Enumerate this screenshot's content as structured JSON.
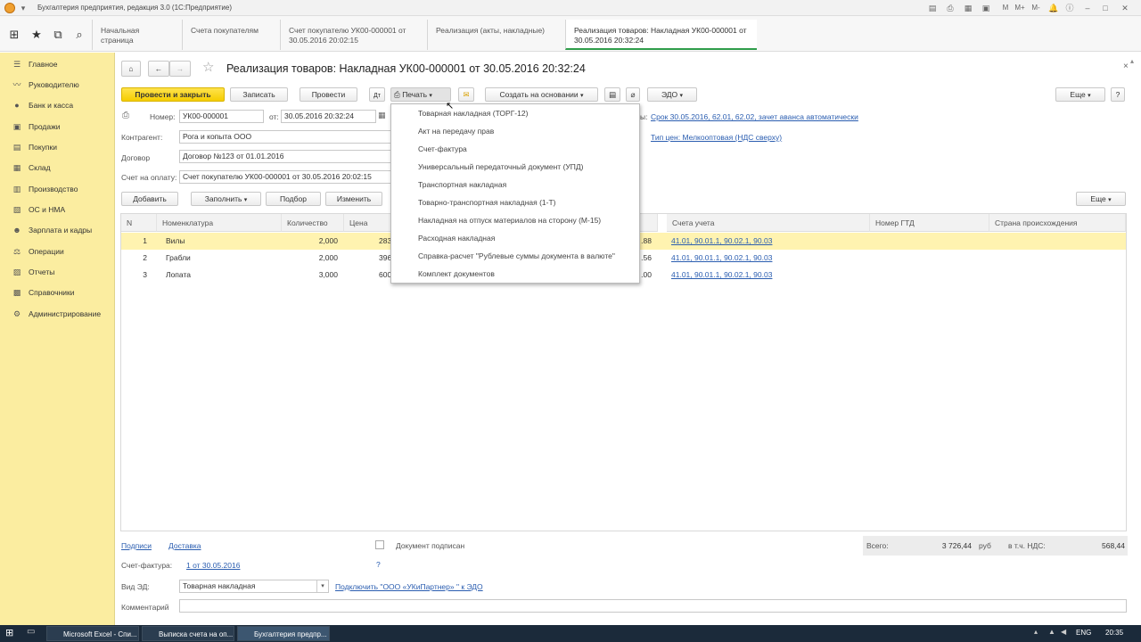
{
  "window": {
    "title": "Бухгалтерия предприятия, редакция 3.0  (1С:Предприятие)"
  },
  "tabs": [
    {
      "label": "Начальная страница"
    },
    {
      "label": "Счета покупателям"
    },
    {
      "label": "Счет покупателю УК00-000001 от 30.05.2016 20:02:15"
    },
    {
      "label": "Реализация (акты, накладные)"
    },
    {
      "label": "Реализация товаров: Накладная УК00-000001 от 30.05.2016 20:32:24"
    }
  ],
  "sidebar": {
    "items": [
      {
        "label": "Главное",
        "icon": "menu-icon"
      },
      {
        "label": "Руководителю",
        "icon": "chart-icon"
      },
      {
        "label": "Банк и касса",
        "icon": "bank-icon"
      },
      {
        "label": "Продажи",
        "icon": "cart-icon"
      },
      {
        "label": "Покупки",
        "icon": "basket-icon"
      },
      {
        "label": "Склад",
        "icon": "warehouse-icon"
      },
      {
        "label": "Производство",
        "icon": "factory-icon"
      },
      {
        "label": "ОС и НМА",
        "icon": "assets-icon"
      },
      {
        "label": "Зарплата и кадры",
        "icon": "people-icon"
      },
      {
        "label": "Операции",
        "icon": "operations-icon"
      },
      {
        "label": "Отчеты",
        "icon": "reports-icon"
      },
      {
        "label": "Справочники",
        "icon": "books-icon"
      },
      {
        "label": "Администрирование",
        "icon": "gear-icon"
      }
    ]
  },
  "doc": {
    "title": "Реализация товаров: Накладная УК00-000001 от 30.05.2016 20:32:24"
  },
  "toolbar": {
    "post_close": "Провести и закрыть",
    "save": "Записать",
    "post": "Провести",
    "print": "Печать",
    "create_based": "Создать на основании",
    "edo": "ЭДО",
    "more": "Еще",
    "help": "?"
  },
  "form": {
    "number_label": "Номер:",
    "number": "УК00-000001",
    "date_label": "от:",
    "date": "30.05.2016 20:32:24",
    "contractor_label": "Контрагент:",
    "contractor": "Рога и копыта ООО",
    "contract_label": "Договор",
    "contract": "Договор №123 от 01.01.2016",
    "invoice_label": "Счет на оплату:",
    "invoice": "Счет покупателю УК00-000001 от 30.05.2016 20:02:15",
    "settle_prefix": "ы:",
    "settle_link": "Срок 30.05.2016, 62.01, 62.02, зачет аванса автоматически",
    "price_link": "Тип цен: Мелкооптовая (НДС сверху)"
  },
  "grid_toolbar": {
    "add": "Добавить",
    "fill": "Заполнить",
    "pick": "Подбор",
    "change": "Изменить",
    "more": "Еще"
  },
  "grid": {
    "headers": [
      "N",
      "Номенклатура",
      "Количество",
      "Цена",
      "Счета учета",
      "Номер ГТД",
      "Страна происхождения"
    ],
    "rows": [
      {
        "n": "1",
        "item": "Вилы",
        "qty": "2,000",
        "price": "283",
        "sum": ".88",
        "acc": "41.01, 90.01.1, 90.02.1, 90.03"
      },
      {
        "n": "2",
        "item": "Грабли",
        "qty": "2,000",
        "price": "396",
        "sum": ".56",
        "acc": "41.01, 90.01.1, 90.02.1, 90.03"
      },
      {
        "n": "3",
        "item": "Лопата",
        "qty": "3,000",
        "price": "600",
        "sum": ".00",
        "acc": "41.01, 90.01.1, 90.02.1, 90.03"
      }
    ]
  },
  "print_menu": [
    "Товарная накладная (ТОРГ-12)",
    "Акт на передачу прав",
    "Счет-фактура",
    "Универсальный передаточный документ (УПД)",
    "Транспортная накладная",
    "Товарно-транспортная накладная (1-Т)",
    "Накладная на отпуск материалов на сторону (М-15)",
    "Расходная накладная",
    "Справка-расчет \"Рублевые суммы документа в валюте\"",
    "Комплект документов"
  ],
  "footer": {
    "signatures": "Подписи",
    "delivery": "Доставка",
    "signed_label": "Документ подписан",
    "total_label": "Всего:",
    "total": "3 726,44",
    "currency": "руб",
    "vat_label": "в т.ч. НДС:",
    "vat": "568,44",
    "sf_label": "Счет-фактура:",
    "sf_link": "1 от 30.05.2016",
    "help": "?",
    "ed_label": "Вид ЭД:",
    "ed_value": "Товарная накладная",
    "ed_link": "Подключить \"ООО «УКиПартнер» \" к ЭДО",
    "comment_label": "Комментарий"
  },
  "taskbar": {
    "items": [
      "Microsoft Excel - Спи...",
      "Выписка счета на оп...",
      "Бухгалтерия предпр..."
    ],
    "lang": "ENG",
    "time": "20:35"
  },
  "colors": {
    "sidebar": "#fbeda0",
    "accent_button": "#f5cd00",
    "link": "#2a5db0",
    "selected_row": "#fff3b0"
  }
}
